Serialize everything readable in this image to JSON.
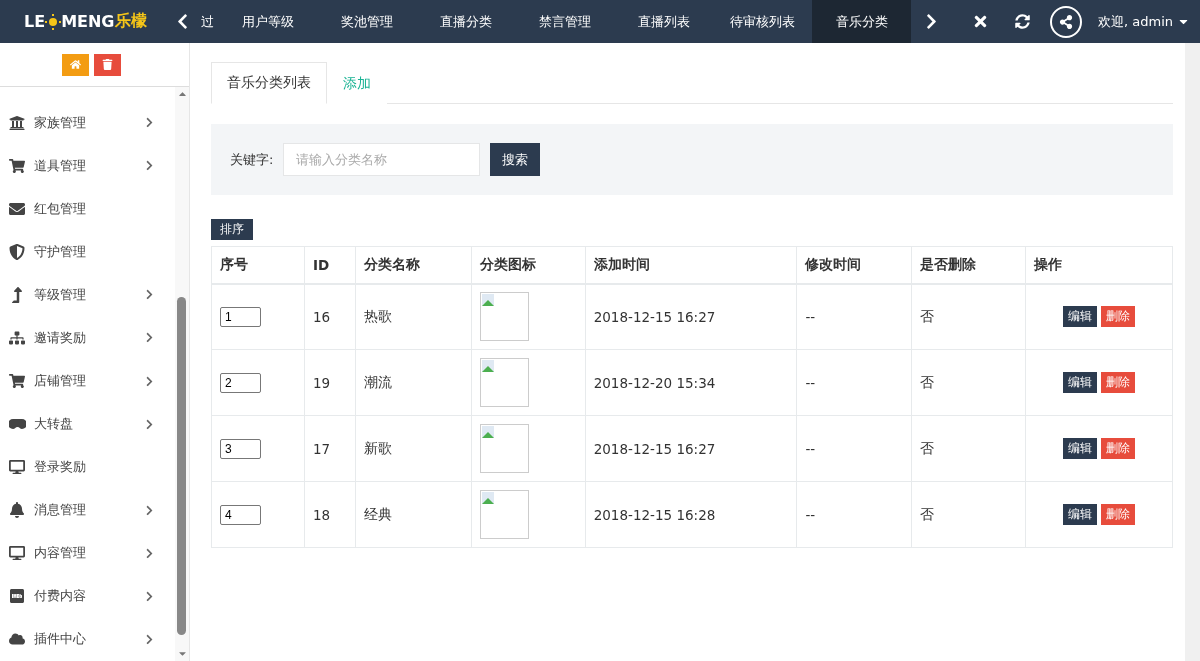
{
  "logo": {
    "lead": "LE",
    "tail": "MENG",
    "cn": "乐檬"
  },
  "nav_tabs": [
    {
      "label": "过",
      "selected": false
    },
    {
      "label": "用户等级",
      "selected": false
    },
    {
      "label": "奖池管理",
      "selected": false
    },
    {
      "label": "直播分类",
      "selected": false
    },
    {
      "label": "禁言管理",
      "selected": false
    },
    {
      "label": "直播列表",
      "selected": false
    },
    {
      "label": "待审核列表",
      "selected": false
    },
    {
      "label": "音乐分类",
      "selected": true
    }
  ],
  "user": {
    "greeting": "欢迎, admin"
  },
  "sidebar": {
    "items": [
      {
        "label": "家族管理",
        "expandable": true
      },
      {
        "label": "道具管理",
        "expandable": true
      },
      {
        "label": "红包管理",
        "expandable": false
      },
      {
        "label": "守护管理",
        "expandable": false
      },
      {
        "label": "等级管理",
        "expandable": true
      },
      {
        "label": "邀请奖励",
        "expandable": true
      },
      {
        "label": "店铺管理",
        "expandable": true
      },
      {
        "label": "大转盘",
        "expandable": true
      },
      {
        "label": "登录奖励",
        "expandable": false
      },
      {
        "label": "消息管理",
        "expandable": true
      },
      {
        "label": "内容管理",
        "expandable": true
      },
      {
        "label": "付费内容",
        "expandable": true
      },
      {
        "label": "插件中心",
        "expandable": true
      }
    ]
  },
  "tabs": [
    {
      "label": "音乐分类列表",
      "selected": true
    },
    {
      "label": "添加",
      "selected": false
    }
  ],
  "search": {
    "label": "关键字:",
    "placeholder": "请输入分类名称",
    "button": "搜索"
  },
  "sort_button": "排序",
  "table": {
    "columns": [
      "序号",
      "ID",
      "分类名称",
      "分类图标",
      "添加时间",
      "修改时间",
      "是否删除",
      "操作"
    ],
    "rows": [
      {
        "order": "1",
        "id": "16",
        "name": "热歌",
        "added": "2018-12-15 16:27",
        "modified": "--",
        "deleted": "否",
        "edit": "编辑",
        "remove": "删除"
      },
      {
        "order": "2",
        "id": "19",
        "name": "潮流",
        "added": "2018-12-20 15:34",
        "modified": "--",
        "deleted": "否",
        "edit": "编辑",
        "remove": "删除"
      },
      {
        "order": "3",
        "id": "17",
        "name": "新歌",
        "added": "2018-12-15 16:27",
        "modified": "--",
        "deleted": "否",
        "edit": "编辑",
        "remove": "删除"
      },
      {
        "order": "4",
        "id": "18",
        "name": "经典",
        "added": "2018-12-15 16:28",
        "modified": "--",
        "deleted": "否",
        "edit": "编辑",
        "remove": "删除"
      }
    ]
  }
}
